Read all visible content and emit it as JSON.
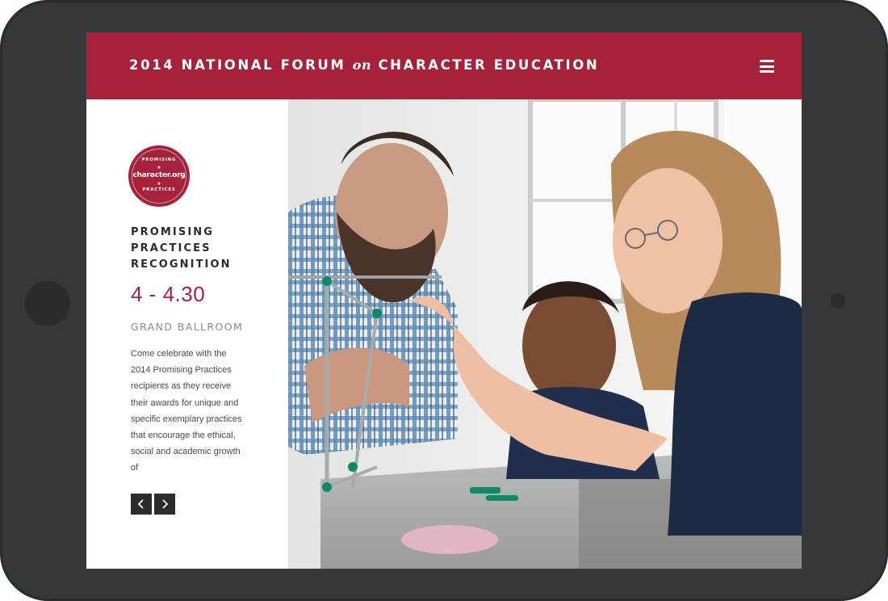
{
  "header": {
    "title_part1": "2014 NATIONAL FORUM ",
    "title_on": "on",
    "title_part2": " CHARACTER EDUCATION",
    "menu_icon": "hamburger-menu-icon"
  },
  "badge": {
    "top_text": "PROMISING",
    "main_text": "character.org",
    "bottom_text": "PRACTICES",
    "star": "★"
  },
  "event": {
    "title_line1": "PROMISING",
    "title_line2": "PRACTICES",
    "title_line3": "RECOGNITION",
    "time": "4 - 4.30",
    "location": "GRAND BALLROOM",
    "description": "Come celebrate with the 2014 Promising Practices recipients as they receive their awards for unique and specific exemplary practices that encourage the ethical, social and academic growth of"
  },
  "navigation": {
    "prev_icon": "chevron-left-icon",
    "next_icon": "chevron-right-icon"
  },
  "colors": {
    "brand": "#a6223b",
    "device_frame": "#34383b",
    "dark_button": "#2b2b2b"
  }
}
